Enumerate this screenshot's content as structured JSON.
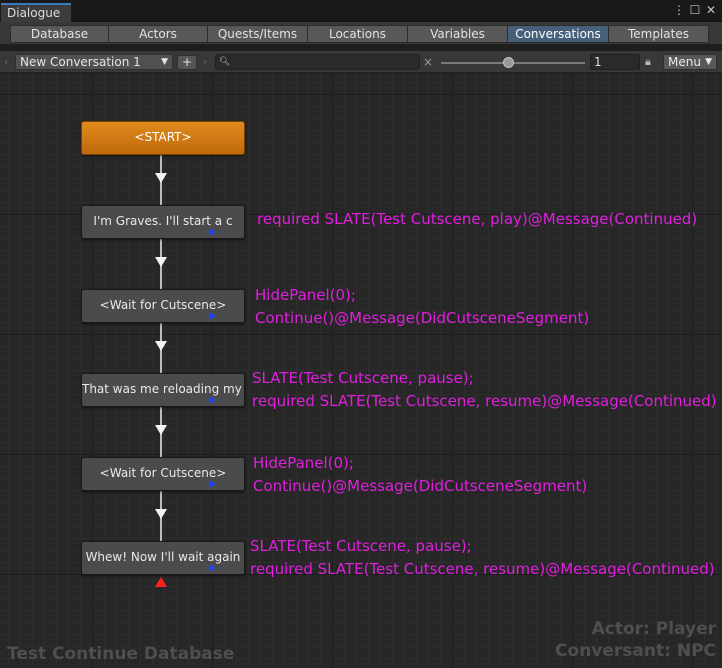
{
  "window": {
    "title": "Dialogue",
    "more_glyph": "⋮",
    "maximize_glyph": "☐",
    "close_glyph": "✕"
  },
  "tabs": [
    "Database",
    "Actors",
    "Quests/Items",
    "Locations",
    "Variables",
    "Conversations",
    "Templates"
  ],
  "active_tab": "Conversations",
  "toolbar": {
    "conversation": "New Conversation 1",
    "add_label": "+",
    "search_placeholder": "",
    "clear_glyph": "×",
    "zoom_value": "1",
    "menu_label": "Menu",
    "slider_fraction": 0.47
  },
  "nodes": [
    {
      "title": "<START>",
      "type": "start",
      "script": []
    },
    {
      "title": "I'm Graves. I'll start a c",
      "type": "dialogue",
      "script": [
        "required SLATE(Test Cutscene, play)@Message(Continued)"
      ]
    },
    {
      "title": "<Wait for Cutscene>",
      "type": "dialogue",
      "script": [
        "HidePanel(0);",
        "Continue()@Message(DidCutsceneSegment)"
      ]
    },
    {
      "title": "That was me reloading my r",
      "type": "dialogue",
      "script": [
        "SLATE(Test Cutscene, pause);",
        "required SLATE(Test Cutscene, resume)@Message(Continued)"
      ]
    },
    {
      "title": "<Wait for Cutscene>",
      "type": "dialogue",
      "script": [
        "HidePanel(0);",
        "Continue()@Message(DidCutsceneSegment)"
      ]
    },
    {
      "title": "Whew! Now I'll wait again",
      "type": "dialogue",
      "script": [
        "SLATE(Test Cutscene, pause);",
        "required SLATE(Test Cutscene, resume)@Message(Continued)"
      ]
    }
  ],
  "watermark": {
    "database": "Test Continue Database",
    "actor": "Actor: Player",
    "conversant": "Conversant: NPC"
  },
  "colors": {
    "start_node": "#d67d14",
    "node": "#4b4b4b",
    "script_text": "#e21ee0",
    "active_tab": "#46607c",
    "link_arrow": "#f4f4f4",
    "end_arrow": "#ff2020",
    "output_port": "#1d44ff"
  },
  "icons": [
    "left-arrow-icon",
    "right-arrow-icon",
    "search-icon",
    "clear-icon",
    "lock-icon",
    "dropdown-caret-icon",
    "output-port-icon"
  ]
}
